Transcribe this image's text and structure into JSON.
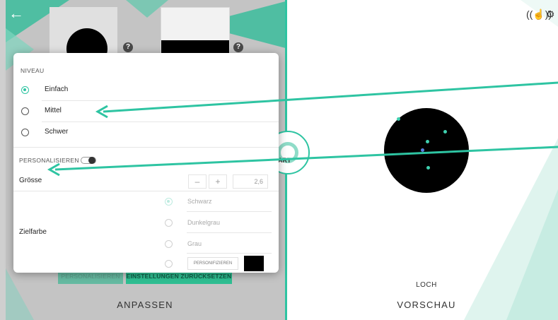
{
  "left_pane": {
    "label": "ANPASSEN",
    "back_icon": "arrow-left-icon",
    "help_icon_text": "?",
    "footer": {
      "personalize_label": "PERSONALISIEREN",
      "reset_label": "EINSTELLUNGEN ZURÜCKSETZEN"
    }
  },
  "center": {
    "label": "ART"
  },
  "right_pane": {
    "mode_label": "LOCH",
    "label": "VORSCHAU",
    "icons": [
      "touch-signal-icon",
      "gear-icon"
    ]
  },
  "panel": {
    "niveau": {
      "title": "NIVEAU",
      "options": [
        {
          "label": "Einfach",
          "selected": true
        },
        {
          "label": "Mittel",
          "selected": false
        },
        {
          "label": "Schwer",
          "selected": false
        }
      ]
    },
    "personalize": {
      "title": "PERSONALISIEREN",
      "enabled": false
    },
    "size": {
      "label": "Grösse",
      "minus": "–",
      "plus": "+",
      "value": "2,6"
    },
    "target_color": {
      "label": "Zielfarbe",
      "options": [
        {
          "label": "Schwarz",
          "selected": true
        },
        {
          "label": "Dunkelgrau",
          "selected": false
        },
        {
          "label": "Grau",
          "selected": false
        }
      ],
      "custom_label": "PERSONIFIZIEREN",
      "custom_color": "#000000"
    }
  },
  "colors": {
    "accent": "#2ec4a2",
    "pane_bg": "#c4c4c4"
  }
}
